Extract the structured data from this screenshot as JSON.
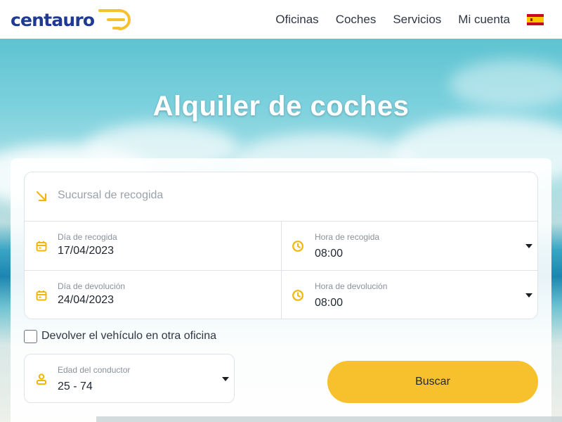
{
  "header": {
    "logo_text": "centauro",
    "nav": [
      "Oficinas",
      "Coches",
      "Servicios",
      "Mi cuenta"
    ],
    "flag_icon": "spain-flag-icon"
  },
  "hero": {
    "title": "Alquiler de coches"
  },
  "form": {
    "pickup_branch_placeholder": "Sucursal de recogida",
    "pickup_date": {
      "label": "Día de recogida",
      "value": "17/04/2023"
    },
    "pickup_time": {
      "label": "Hora de recogida",
      "value": "08:00"
    },
    "return_date": {
      "label": "Día de devolución",
      "value": "24/04/2023"
    },
    "return_time": {
      "label": "Hora de devolución",
      "value": "08:00"
    },
    "return_other_office_label": "Devolver el vehículo en otra oficina",
    "return_other_office_checked": false,
    "driver_age": {
      "label": "Edad del conductor",
      "value": "25 - 74"
    },
    "search_button": "Buscar"
  },
  "colors": {
    "accent": "#f7c12e",
    "brand": "#1f3a93",
    "icon": "#f2b705"
  }
}
